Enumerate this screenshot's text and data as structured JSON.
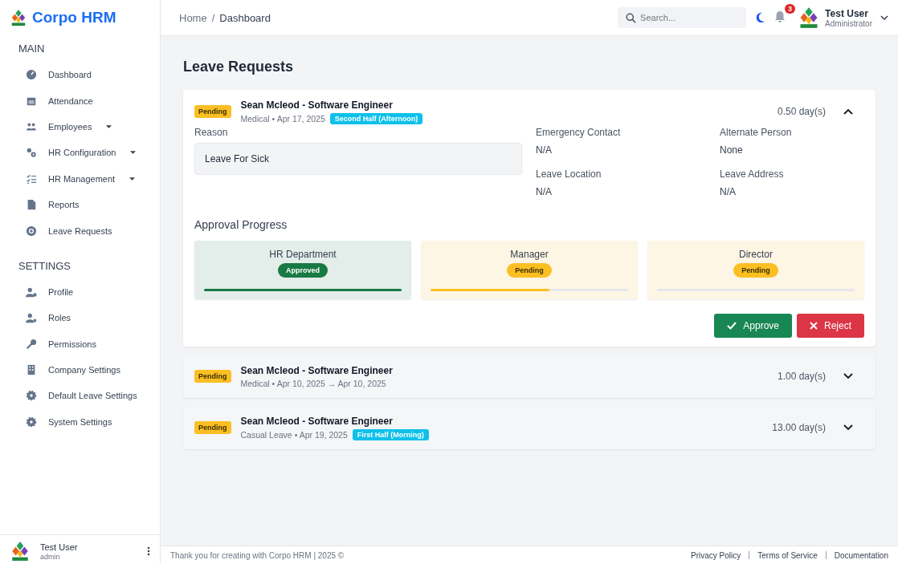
{
  "brand": "Corpo HRM",
  "sidebar": {
    "sections": [
      {
        "title": "MAIN",
        "items": [
          {
            "label": "Dashboard",
            "has_submenu": false
          },
          {
            "label": "Attendance",
            "has_submenu": false
          },
          {
            "label": "Employees",
            "has_submenu": true
          },
          {
            "label": "HR Configuration",
            "has_submenu": true
          },
          {
            "label": "HR Management",
            "has_submenu": true
          },
          {
            "label": "Reports",
            "has_submenu": false
          },
          {
            "label": "Leave Requests",
            "has_submenu": false
          }
        ]
      },
      {
        "title": "SETTINGS",
        "items": [
          {
            "label": "Profile",
            "has_submenu": false
          },
          {
            "label": "Roles",
            "has_submenu": false
          },
          {
            "label": "Permissions",
            "has_submenu": false
          },
          {
            "label": "Company Settings",
            "has_submenu": false
          },
          {
            "label": "Default Leave Settings",
            "has_submenu": false
          },
          {
            "label": "System Settings",
            "has_submenu": false
          }
        ]
      }
    ],
    "user": {
      "name": "Test User",
      "login": "admin"
    }
  },
  "header": {
    "breadcrumb": [
      "Home",
      "Dashboard"
    ],
    "separator": "/",
    "search": {
      "placeholder": "Search..."
    },
    "notifications": "3",
    "user": {
      "name": "Test User",
      "role": "Administrator"
    }
  },
  "page_title": "Leave Requests",
  "meta_separator": "•",
  "requests": [
    {
      "status": "Pending",
      "title": "Sean Mcleod - Software Engineer",
      "type": "Medical",
      "dates": "Apr 17, 2025",
      "half": "Second Half (Afternoon)",
      "days": "0.50 day(s)",
      "expanded": true,
      "details": {
        "reason_label": "Reason",
        "reason": "Leave For Sick",
        "fields": [
          {
            "label": "Emergency Contact",
            "value": "N/A"
          },
          {
            "label": "Alternate Person",
            "value": "None"
          },
          {
            "label": "Leave Location",
            "value": "N/A"
          },
          {
            "label": "Leave Address",
            "value": "N/A"
          }
        ],
        "progress_title": "Approval Progress",
        "stages": [
          {
            "name": "HR Department",
            "status": "Approved",
            "kind": "approved",
            "level": 1
          },
          {
            "name": "Manager",
            "status": "Pending",
            "kind": "pending",
            "level": 0.6
          },
          {
            "name": "Director",
            "status": "Pending",
            "kind": "pending",
            "level": 0
          }
        ],
        "buttons": [
          {
            "label": "Approve",
            "kind": "approve"
          },
          {
            "label": "Reject",
            "kind": "reject"
          }
        ]
      }
    },
    {
      "status": "Pending",
      "title": "Sean Mcleod - Software Engineer",
      "type": "Medical",
      "dates": "Apr 10, 2025 → Apr 10, 2025",
      "days": "1.00 day(s)",
      "expanded": false
    },
    {
      "status": "Pending",
      "title": "Sean Mcleod - Software Engineer",
      "type": "Casual Leave",
      "dates": "Apr 19, 2025",
      "half": "First Half (Morning)",
      "days": "13.00 day(s)",
      "expanded": false
    }
  ],
  "footer": {
    "text": "Thank you for creating with Corpo HRM | 2025 ©",
    "links": [
      "Privacy Policy",
      "Terms of Service",
      "Documentation"
    ]
  }
}
